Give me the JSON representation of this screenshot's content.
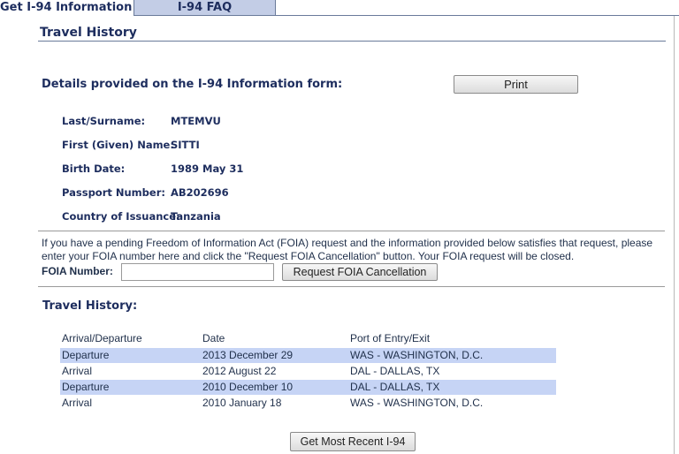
{
  "tabs": [
    "Get I-94 Information",
    "I-94 FAQ"
  ],
  "section_title": "Travel History",
  "details": {
    "heading": "Details provided on the I-94 Information form:",
    "print_label": "Print",
    "fields": [
      {
        "label": "Last/Surname:",
        "value": "MTEMVU"
      },
      {
        "label": "First (Given) Name:",
        "value": "SITTI"
      },
      {
        "label": "Birth Date:",
        "value": "1989 May 31"
      },
      {
        "label": "Passport Number:",
        "value": "AB202696"
      },
      {
        "label": "Country of Issuance:",
        "value": "Tanzania"
      }
    ]
  },
  "foia": {
    "text": "If you have a pending Freedom of Information Act (FOIA) request and the information provided below satisfies that request, please enter your FOIA number here and click the \"Request FOIA Cancellation\" button. Your FOIA request will be closed.",
    "label": "FOIA Number:",
    "input_value": "",
    "button_label": "Request FOIA Cancellation"
  },
  "history": {
    "heading": "Travel History:",
    "columns": [
      "Arrival/Departure",
      "Date",
      "Port of Entry/Exit"
    ],
    "rows": [
      {
        "type": "Departure",
        "date": "2013 December 29",
        "port": "WAS - WASHINGTON, D.C."
      },
      {
        "type": "Arrival",
        "date": "2012 August 22",
        "port": "DAL - DALLAS, TX"
      },
      {
        "type": "Departure",
        "date": "2010 December 10",
        "port": "DAL - DALLAS, TX"
      },
      {
        "type": "Arrival",
        "date": "2010 January 18",
        "port": "WAS - WASHINGTON, D.C."
      }
    ]
  },
  "recent_button_label": "Get Most Recent I-94",
  "colors": {
    "tab_inactive": "#c3cde6",
    "row_highlight": "#c6d4f5",
    "heading": "#1d2d5e"
  }
}
